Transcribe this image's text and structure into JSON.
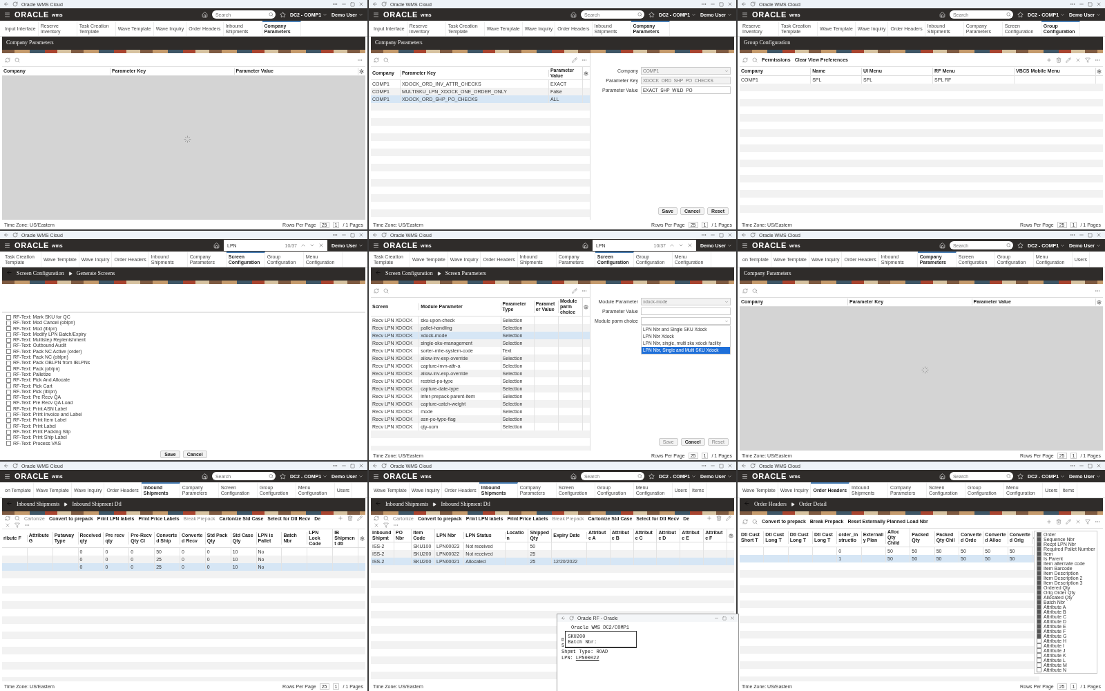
{
  "panels": [
    {
      "window_title": "Oracle WMS Cloud",
      "header": {
        "logo": "ORACLE",
        "product": "wms",
        "search": {
          "placeholder": "Search"
        },
        "facility": "DC2 - COMP1",
        "user": "Demo User"
      },
      "tabs": [
        {
          "label": "Input Interface",
          "selected": false
        },
        {
          "label": "Reserve Inventory",
          "selected": false
        },
        {
          "label": "Task Creation Template",
          "selected": false
        },
        {
          "label": "Wave Template",
          "selected": false
        },
        {
          "label": "Wave Inquiry",
          "selected": false
        },
        {
          "label": "Order Headers",
          "selected": false
        },
        {
          "label": "Inbound Shipments",
          "selected": false
        },
        {
          "label": "Company Parameters",
          "selected": true
        }
      ],
      "breadcrumb": [
        "Company Parameters"
      ],
      "loading": true,
      "table": {
        "columns": [
          "Company",
          "Parameter Key",
          "Parameter Value"
        ]
      },
      "footer": {
        "time_zone": "Time Zone: US/Eastern",
        "rows_label": "Rows Per Page",
        "rows": "25",
        "page": "1",
        "pages": "/ 1 Pages"
      }
    },
    {
      "window_title": "Oracle WMS Cloud",
      "header": {
        "logo": "ORACLE",
        "product": "wms",
        "search": {
          "placeholder": "Search"
        },
        "facility": "DC2 - COMP1",
        "user": "Demo User"
      },
      "tabs": [
        {
          "label": "Input Interface",
          "selected": false
        },
        {
          "label": "Reserve Inventory",
          "selected": false
        },
        {
          "label": "Task Creation Template",
          "selected": false
        },
        {
          "label": "Wave Template",
          "selected": false
        },
        {
          "label": "Wave Inquiry",
          "selected": false
        },
        {
          "label": "Order Headers",
          "selected": false
        },
        {
          "label": "Inbound Shipments",
          "selected": false
        },
        {
          "label": "Company Parameters",
          "selected": true
        }
      ],
      "breadcrumb": [
        "Company Parameters"
      ],
      "loading": false,
      "table": {
        "columns": [
          "Company",
          "Parameter Key",
          "Parameter Value"
        ],
        "rows": [
          {
            "cells": [
              "COMP1",
              "XDOCK_ORD_INV_ATTR_CHECKS",
              "EXACT"
            ],
            "selected": false
          },
          {
            "cells": [
              "COMP1",
              "MULTISKU_LPN_XDOCK_ONE_ORDER_ONLY",
              "False"
            ],
            "selected": false
          },
          {
            "cells": [
              "COMP1",
              "XDOCK_ORD_SHP_PO_CHECKS",
              "ALL"
            ],
            "selected": true
          }
        ]
      },
      "form": {
        "fields": [
          {
            "kind": "select",
            "label": "Company",
            "value": "COMP1",
            "disabled": true
          },
          {
            "kind": "text",
            "label": "Parameter Key",
            "value": "XDOCK_ORD_SHP_PO_CHECKS",
            "disabled": true
          },
          {
            "kind": "text",
            "label": "Parameter Value",
            "value": "EXACT_SHP_WILD_PO",
            "disabled": false
          }
        ],
        "buttons": [
          {
            "label": "Save",
            "disabled": false
          },
          {
            "label": "Cancel",
            "disabled": false
          },
          {
            "label": "Reset",
            "disabled": false
          }
        ]
      },
      "footer": {
        "time_zone": "Time Zone: US/Eastern",
        "rows_label": "Rows Per Page",
        "rows": "25",
        "page": "1",
        "pages": "/ 1 Pages"
      }
    },
    {
      "window_title": "Oracle WMS Cloud",
      "header": {
        "logo": "ORACLE",
        "product": "wms",
        "search": {
          "placeholder": "Search"
        },
        "facility": "DC2 - COMP1",
        "user": "Demo User"
      },
      "tabs": [
        {
          "label": "Reserve Inventory",
          "selected": false
        },
        {
          "label": "Task Creation Template",
          "selected": false
        },
        {
          "label": "Wave Template",
          "selected": false
        },
        {
          "label": "Wave Inquiry",
          "selected": false
        },
        {
          "label": "Order Headers",
          "selected": false
        },
        {
          "label": "Inbound Shipments",
          "selected": false
        },
        {
          "label": "Company Parameters",
          "selected": false
        },
        {
          "label": "Screen Configuration",
          "selected": false
        },
        {
          "label": "Group Configuration",
          "selected": true
        }
      ],
      "breadcrumb": [
        "Group Configuration"
      ],
      "loading": false,
      "toolbar": {
        "actions": [
          {
            "label": "Permissions",
            "disabled": false
          },
          {
            "label": "Clear View Preferences",
            "disabled": false
          }
        ]
      },
      "table": {
        "columns": [
          "Company",
          "Name",
          "UI Menu",
          "RF Menu",
          "VBCS Mobile Menu"
        ],
        "rows": [
          {
            "cells": [
              "COMP1",
              "SPL",
              "SPL",
              "SPL RF",
              ""
            ],
            "selected": false
          }
        ]
      },
      "footer": {
        "time_zone": "Time Zone: US/Eastern",
        "rows_label": "Rows Per Page",
        "rows": "25",
        "page": "1",
        "pages": "/ 1 Pages"
      }
    },
    {
      "window_title": "Oracle WMS Cloud",
      "header": {
        "logo": "ORACLE",
        "product": "wms",
        "find": {
          "query": "LPN",
          "count": "10/37"
        },
        "user": "Demo User"
      },
      "tabs": [
        {
          "label": "Task Creation Template",
          "selected": false
        },
        {
          "label": "Wave Template",
          "selected": false
        },
        {
          "label": "Wave Inquiry",
          "selected": false
        },
        {
          "label": "Order Headers",
          "selected": false
        },
        {
          "label": "Inbound Shipments",
          "selected": false
        },
        {
          "label": "Company Parameters",
          "selected": false
        },
        {
          "label": "Screen Configuration",
          "selected": true
        },
        {
          "label": "Group Configuration",
          "selected": false
        },
        {
          "label": "Menu Configuration",
          "selected": false
        }
      ],
      "breadcrumb": [
        "Screen Configuration",
        "Generate Screens"
      ],
      "checklist": {
        "items": [
          {
            "label": "RF-Text: Mark SKU for QC",
            "checked": false
          },
          {
            "label": "RF-Text: Mod Cancel (oblpn)",
            "checked": false
          },
          {
            "label": "RF-Text: Mod (iblpn)",
            "checked": false
          },
          {
            "label": "RF-Text: Modify LPN Batch/Expiry",
            "checked": false
          },
          {
            "label": "RF-Text: Multistep Replenishment",
            "checked": false
          },
          {
            "label": "RF-Text: Outbound Audit",
            "checked": false
          },
          {
            "label": "RF-Text: Pack NC Active (order)",
            "checked": false
          },
          {
            "label": "RF-Text: Pack NC (oblpn)",
            "checked": false
          },
          {
            "label": "RF-Text: Pack OBLPN from IBLPNs",
            "checked": false
          },
          {
            "label": "RF-Text: Pack (oblpn)",
            "checked": false
          },
          {
            "label": "RF-Text: Palletize",
            "checked": false
          },
          {
            "label": "RF-Text: Pick And Allocate",
            "checked": false
          },
          {
            "label": "RF-Text: Pick Cart",
            "checked": false
          },
          {
            "label": "RF-Text: Pick (iblpn)",
            "checked": false
          },
          {
            "label": "RF-Text: Pre Recv QA",
            "checked": false
          },
          {
            "label": "RF-Text: Pre Recv QA Load",
            "checked": false
          },
          {
            "label": "RF-Text: Print ASN Label",
            "checked": false
          },
          {
            "label": "RF-Text: Print Invoice and Label",
            "checked": false
          },
          {
            "label": "RF-Text: Print Item Label",
            "checked": false
          },
          {
            "label": "RF-Text: Print Label",
            "checked": false
          },
          {
            "label": "RF-Text: Print Packing Slip",
            "checked": false
          },
          {
            "label": "RF-Text: Print Ship Label",
            "checked": false
          },
          {
            "label": "RF-Text: Process VAS",
            "checked": false
          }
        ],
        "buttons": [
          {
            "label": "Save",
            "disabled": false
          },
          {
            "label": "Cancel",
            "disabled": false
          }
        ]
      }
    },
    {
      "window_title": "Oracle WMS Cloud",
      "header": {
        "logo": "ORACLE",
        "product": "wms",
        "find": {
          "query": "LPN",
          "count": "10/37"
        },
        "user": "Demo User"
      },
      "tabs": [
        {
          "label": "Task Creation Template",
          "selected": false
        },
        {
          "label": "Wave Template",
          "selected": false
        },
        {
          "label": "Wave Inquiry",
          "selected": false
        },
        {
          "label": "Order Headers",
          "selected": false
        },
        {
          "label": "Inbound Shipments",
          "selected": false
        },
        {
          "label": "Company Parameters",
          "selected": false
        },
        {
          "label": "Screen Configuration",
          "selected": true
        },
        {
          "label": "Group Configuration",
          "selected": false
        },
        {
          "label": "Menu Configuration",
          "selected": false
        }
      ],
      "breadcrumb": [
        "Screen Configuration",
        "Screen Parameters"
      ],
      "loading": false,
      "table": {
        "columns": [
          "Screen",
          "Module Parameter",
          "Parameter Type",
          "Parameter Value",
          "Module parm choice"
        ],
        "rows": [
          {
            "cells": [
              "Recv LPN XDOCK",
              "sku-upon-check",
              "Selection",
              "",
              ""
            ],
            "selected": false
          },
          {
            "cells": [
              "Recv LPN XDOCK",
              "pallet-handling",
              "Selection",
              "",
              ""
            ],
            "selected": false
          },
          {
            "cells": [
              "Recv LPN XDOCK",
              "xdock-mode",
              "Selection",
              "",
              ""
            ],
            "selected": true
          },
          {
            "cells": [
              "Recv LPN XDOCK",
              "single-sku-management",
              "Selection",
              "",
              ""
            ],
            "selected": false
          },
          {
            "cells": [
              "Recv LPN XDOCK",
              "sorter-mhe-system-code",
              "Text",
              "",
              ""
            ],
            "selected": false
          },
          {
            "cells": [
              "Recv LPN XDOCK",
              "allow-inv-exp-override",
              "Selection",
              "",
              ""
            ],
            "selected": false
          },
          {
            "cells": [
              "Recv LPN XDOCK",
              "capture-invn-attr-a",
              "Selection",
              "",
              ""
            ],
            "selected": false
          },
          {
            "cells": [
              "Recv LPN XDOCK",
              "allow-inv-exp-override",
              "Selection",
              "",
              ""
            ],
            "selected": false
          },
          {
            "cells": [
              "Recv LPN XDOCK",
              "restrict-po-type",
              "Selection",
              "",
              ""
            ],
            "selected": false
          },
          {
            "cells": [
              "Recv LPN XDOCK",
              "capture-date-type",
              "Selection",
              "",
              ""
            ],
            "selected": false
          },
          {
            "cells": [
              "Recv LPN XDOCK",
              "infer-prepack-parent-item",
              "Selection",
              "",
              ""
            ],
            "selected": false
          },
          {
            "cells": [
              "Recv LPN XDOCK",
              "capture-catch-weight",
              "Selection",
              "",
              ""
            ],
            "selected": false
          },
          {
            "cells": [
              "Recv LPN XDOCK",
              "mode",
              "Selection",
              "",
              ""
            ],
            "selected": false
          },
          {
            "cells": [
              "Recv LPN XDOCK",
              "asn-po-type-flag",
              "Selection",
              "",
              ""
            ],
            "selected": false
          },
          {
            "cells": [
              "Recv LPN XDOCK",
              "qty-uom",
              "Selection",
              "",
              ""
            ],
            "selected": false
          }
        ]
      },
      "form": {
        "fields": [
          {
            "kind": "select",
            "label": "Module Parameter",
            "value": "xdock-mode",
            "disabled": true
          },
          {
            "kind": "text",
            "label": "Parameter Value",
            "disabled": false
          },
          {
            "kind": "select",
            "label": "Module parm choice",
            "disabled": false,
            "options": [
              {
                "label": "LPN Nbr and Single SKU Xdock",
                "selected": false
              },
              {
                "label": "LPN Nbr Xdock",
                "selected": false
              },
              {
                "label": "LPN Nbr, single, multi sku xdock facility",
                "selected": false
              },
              {
                "label": "LPN Nbr, Single and Multi SKU Xdock",
                "selected": true
              }
            ]
          }
        ],
        "buttons": [
          {
            "label": "Save",
            "disabled": true
          },
          {
            "label": "Cancel",
            "disabled": false
          },
          {
            "label": "Reset",
            "disabled": true
          }
        ]
      },
      "footer": {
        "time_zone": "Time Zone: US/Eastern",
        "rows_label": "Rows Per Page",
        "rows": "25",
        "page": "1",
        "pages": "/ 1 Pages"
      }
    },
    {
      "window_title": "Oracle WMS Cloud",
      "header": {
        "logo": "ORACLE",
        "product": "wms",
        "search": {
          "placeholder": "Search"
        },
        "facility": "DC2 - COMP1",
        "user": "Demo User"
      },
      "tabs": [
        {
          "label": "on Template",
          "selected": false
        },
        {
          "label": "Wave Template",
          "selected": false
        },
        {
          "label": "Wave Inquiry",
          "selected": false
        },
        {
          "label": "Order Headers",
          "selected": false
        },
        {
          "label": "Inbound Shipments",
          "selected": false
        },
        {
          "label": "Company Parameters",
          "selected": true
        },
        {
          "label": "Screen Configuration",
          "selected": false
        },
        {
          "label": "Group Configuration",
          "selected": false
        },
        {
          "label": "Menu Configuration",
          "selected": false
        },
        {
          "label": "Users",
          "selected": false
        }
      ],
      "breadcrumb": [
        "Company Parameters"
      ],
      "loading": true,
      "table": {
        "columns": [
          "Company",
          "Parameter Key",
          "Parameter Value"
        ]
      },
      "footer": {
        "time_zone": "Time Zone: US/Eastern",
        "rows_label": "Rows Per Page",
        "rows": "25",
        "page": "1",
        "pages": "/ 1 Pages"
      }
    },
    {
      "window_title": "Oracle WMS Cloud",
      "header": {
        "logo": "ORACLE",
        "product": "wms",
        "search": {
          "placeholder": "Search"
        },
        "facility": "DC2 - COMP1",
        "user": "Demo User"
      },
      "tabs": [
        {
          "label": "on Template",
          "selected": false
        },
        {
          "label": "Wave Template",
          "selected": false
        },
        {
          "label": "Wave Inquiry",
          "selected": false
        },
        {
          "label": "Order Headers",
          "selected": false
        },
        {
          "label": "Inbound Shipments",
          "selected": true
        },
        {
          "label": "Company Parameters",
          "selected": false
        },
        {
          "label": "Screen Configuration",
          "selected": false
        },
        {
          "label": "Group Configuration",
          "selected": false
        },
        {
          "label": "Menu Configuration",
          "selected": false
        },
        {
          "label": "Users",
          "selected": false
        }
      ],
      "breadcrumb": [
        "Inbound Shipments",
        "Inbound Shipment Dtl"
      ],
      "loading": false,
      "toolbar": {
        "actions": [
          {
            "label": "Cartonize",
            "disabled": true
          },
          {
            "label": "Convert to prepack",
            "disabled": false
          },
          {
            "label": "Print LPN labels",
            "disabled": false
          },
          {
            "label": "Print Price Labels",
            "disabled": false
          },
          {
            "label": "Break Prepack",
            "disabled": true
          },
          {
            "label": "Cartonize Std Case",
            "disabled": false
          },
          {
            "label": "Select for Dtl Recv",
            "disabled": false
          },
          {
            "label": "De",
            "disabled": false
          }
        ]
      },
      "table": {
        "columns": [
          "ribute F",
          "Attribute G",
          "Putaway Type",
          "Received qty",
          "Pre recv qty",
          "Pre-Recv Qty Cl",
          "Converted Ship",
          "Converted Recv",
          "Std Pack Qty",
          "Std Case Qty",
          "LPN is Pallet",
          "Batch Nbr",
          "LPN Lock Code",
          "IB Shipment dtl"
        ],
        "rows": [
          {
            "cells": [
              "",
              "",
              "",
              "0",
              "0",
              "0",
              "50",
              "0",
              "0",
              "10",
              "No",
              "",
              "",
              ""
            ],
            "selected": false
          },
          {
            "cells": [
              "",
              "",
              "",
              "0",
              "0",
              "0",
              "25",
              "0",
              "0",
              "10",
              "No",
              "",
              "",
              ""
            ],
            "selected": false
          },
          {
            "cells": [
              "",
              "",
              "",
              "0",
              "0",
              "0",
              "25",
              "0",
              "0",
              "10",
              "No",
              "",
              "",
              ""
            ],
            "selected": true
          }
        ]
      },
      "footer": {
        "time_zone": "Time Zone: US/Eastern",
        "rows_label": "Rows Per Page",
        "rows": "25",
        "page": "1",
        "pages": "/ 1 Pages"
      }
    },
    {
      "window_title": "Oracle WMS Cloud",
      "header": {
        "logo": "ORACLE",
        "product": "wms",
        "search": {
          "placeholder": "Search"
        },
        "facility": "DC2 - COMP1",
        "user": "Demo User"
      },
      "tabs": [
        {
          "label": "Wave Template",
          "selected": false
        },
        {
          "label": "Wave Inquiry",
          "selected": false
        },
        {
          "label": "Order Headers",
          "selected": false
        },
        {
          "label": "Inbound Shipments",
          "selected": true
        },
        {
          "label": "Company Parameters",
          "selected": false
        },
        {
          "label": "Screen Configuration",
          "selected": false
        },
        {
          "label": "Group Configuration",
          "selected": false
        },
        {
          "label": "Menu Configuration",
          "selected": false
        },
        {
          "label": "Users",
          "selected": false
        },
        {
          "label": "Items",
          "selected": false
        }
      ],
      "breadcrumb": [
        "Inbound Shipments",
        "Inbound Shipment Dtl"
      ],
      "loading": false,
      "toolbar": {
        "actions": [
          {
            "label": "Cartonize",
            "disabled": true
          },
          {
            "label": "Convert to prepack",
            "disabled": false
          },
          {
            "label": "Print LPN labels",
            "disabled": false
          },
          {
            "label": "Print Price Labels",
            "disabled": false
          },
          {
            "label": "Break Prepack",
            "disabled": true
          },
          {
            "label": "Cartonize Std Case",
            "disabled": false
          },
          {
            "label": "Select for Dtl Recv",
            "disabled": false
          },
          {
            "label": "De",
            "disabled": false
          }
        ]
      },
      "table": {
        "columns": [
          "Inbound Shipmt",
          "PO Nbr",
          "Item Code",
          "LPN Nbr",
          "LPN Status",
          "Location",
          "Shipped Qty",
          "Expiry Date",
          "Attribute A",
          "Attribute B",
          "Attribute C",
          "Attribute D",
          "Attribute E",
          "Attribute F"
        ],
        "rows": [
          {
            "cells": [
              "ISS-2",
              "",
              "SKU100",
              "LPN00023",
              "Not received",
              "",
              "50",
              "",
              "",
              "",
              "",
              "",
              "",
              ""
            ],
            "selected": false
          },
          {
            "cells": [
              "ISS-2",
              "",
              "SKU200",
              "LPN00022",
              "Not received",
              "",
              "25",
              "",
              "",
              "",
              "",
              "",
              "",
              ""
            ],
            "selected": false
          },
          {
            "cells": [
              "ISS-2",
              "",
              "SKU200",
              "LPN00021",
              "Allocated",
              "",
              "25",
              "12/20/2022",
              "",
              "",
              "",
              "",
              "",
              ""
            ],
            "selected": true
          }
        ]
      },
      "footer": {
        "time_zone": "Time Zone: US/Eastern"
      }
    },
    {
      "window_title": "Oracle WMS Cloud",
      "header": {
        "logo": "ORACLE",
        "product": "wms",
        "search": {
          "placeholder": "Search"
        },
        "facility": "DC2 - COMP1",
        "user": "Demo User"
      },
      "tabs": [
        {
          "label": "Wave Template",
          "selected": false
        },
        {
          "label": "Wave Inquiry",
          "selected": false
        },
        {
          "label": "Order Headers",
          "selected": true
        },
        {
          "label": "Inbound Shipments",
          "selected": false
        },
        {
          "label": "Company Parameters",
          "selected": false
        },
        {
          "label": "Screen Configuration",
          "selected": false
        },
        {
          "label": "Group Configuration",
          "selected": false
        },
        {
          "label": "Menu Configuration",
          "selected": false
        },
        {
          "label": "Users",
          "selected": false
        },
        {
          "label": "Items",
          "selected": false
        }
      ],
      "breadcrumb": [
        "Order Headers",
        "Order Detail"
      ],
      "loading": false,
      "toolbar": {
        "actions": [
          {
            "label": "Convert to prepack",
            "disabled": false
          },
          {
            "label": "Break Prepack",
            "disabled": false
          },
          {
            "label": "Reset Externally Planned Load Nbr",
            "disabled": false
          }
        ]
      },
      "table": {
        "columns": [
          "Dtl Cust Short T",
          "Dtl Cust Long T",
          "Dtl Cust Long T",
          "Dtl Cust Long T",
          "order_instructio",
          "Externally Plan",
          "Alloc Qty Child",
          "Packed Qty",
          "Packed Qty Chil",
          "Converted Orde",
          "Converted Alloc",
          "Converted Orig"
        ],
        "rows": [
          {
            "cells": [
              "",
              "",
              "",
              "",
              "0",
              "",
              "50",
              "50",
              "50",
              "50",
              "50",
              "50"
            ],
            "selected": false
          },
          {
            "cells": [
              "",
              "",
              "",
              "",
              "1",
              "",
              "50",
              "50",
              "50",
              "50",
              "50",
              "50"
            ],
            "selected": true
          }
        ]
      },
      "column_chooser": [
        {
          "label": "Order",
          "checked": true
        },
        {
          "label": "Sequence Nbr",
          "checked": true
        },
        {
          "label": "Recpt LPN Nbr",
          "checked": true
        },
        {
          "label": "Required Pallet Number",
          "checked": true
        },
        {
          "label": "Item",
          "checked": true
        },
        {
          "label": "Is Parent",
          "checked": true
        },
        {
          "label": "Item alternate code",
          "checked": true
        },
        {
          "label": "Item Barcode",
          "checked": true
        },
        {
          "label": "Item Description",
          "checked": true
        },
        {
          "label": "Item Description 2",
          "checked": true
        },
        {
          "label": "Item Description 3",
          "checked": true
        },
        {
          "label": "Ordered Qty",
          "checked": true
        },
        {
          "label": "Orig Order Qty",
          "checked": true
        },
        {
          "label": "Allocated Qty",
          "checked": true
        },
        {
          "label": "Batch Nbr",
          "checked": true
        },
        {
          "label": "Attribute A",
          "checked": true
        },
        {
          "label": "Attribute B",
          "checked": true
        },
        {
          "label": "Attribute C",
          "checked": true
        },
        {
          "label": "Attribute D",
          "checked": true
        },
        {
          "label": "Attribute E",
          "checked": true
        },
        {
          "label": "Attribute F",
          "checked": true
        },
        {
          "label": "Attribute G",
          "checked": true
        },
        {
          "label": "Attribute H",
          "checked": false
        },
        {
          "label": "Attribute I",
          "checked": false
        },
        {
          "label": "Attribute J",
          "checked": false
        },
        {
          "label": "Attribute K",
          "checked": false
        },
        {
          "label": "Attribute L",
          "checked": false
        },
        {
          "label": "Attribute M",
          "checked": false
        },
        {
          "label": "Attribute N",
          "checked": false
        }
      ],
      "footer": {
        "time_zone": "Time Zone: US/Eastern",
        "rows_label": "Rows Per Page",
        "rows": "25",
        "page": "1",
        "pages": "/ 1 Pages"
      }
    }
  ],
  "rf_window": {
    "title": "Oracle RF - Oracle",
    "heading": "Oracle WMS DC2/COMP1",
    "popup_lines": [
      "SKU200",
      "Batch Nbr:"
    ],
    "side_letters": [
      "D",
      "S"
    ],
    "lines": [
      "Shpmt Type: ROAD"
    ],
    "lpn_label": "LPN:",
    "lpn_value": "LPN00022"
  }
}
